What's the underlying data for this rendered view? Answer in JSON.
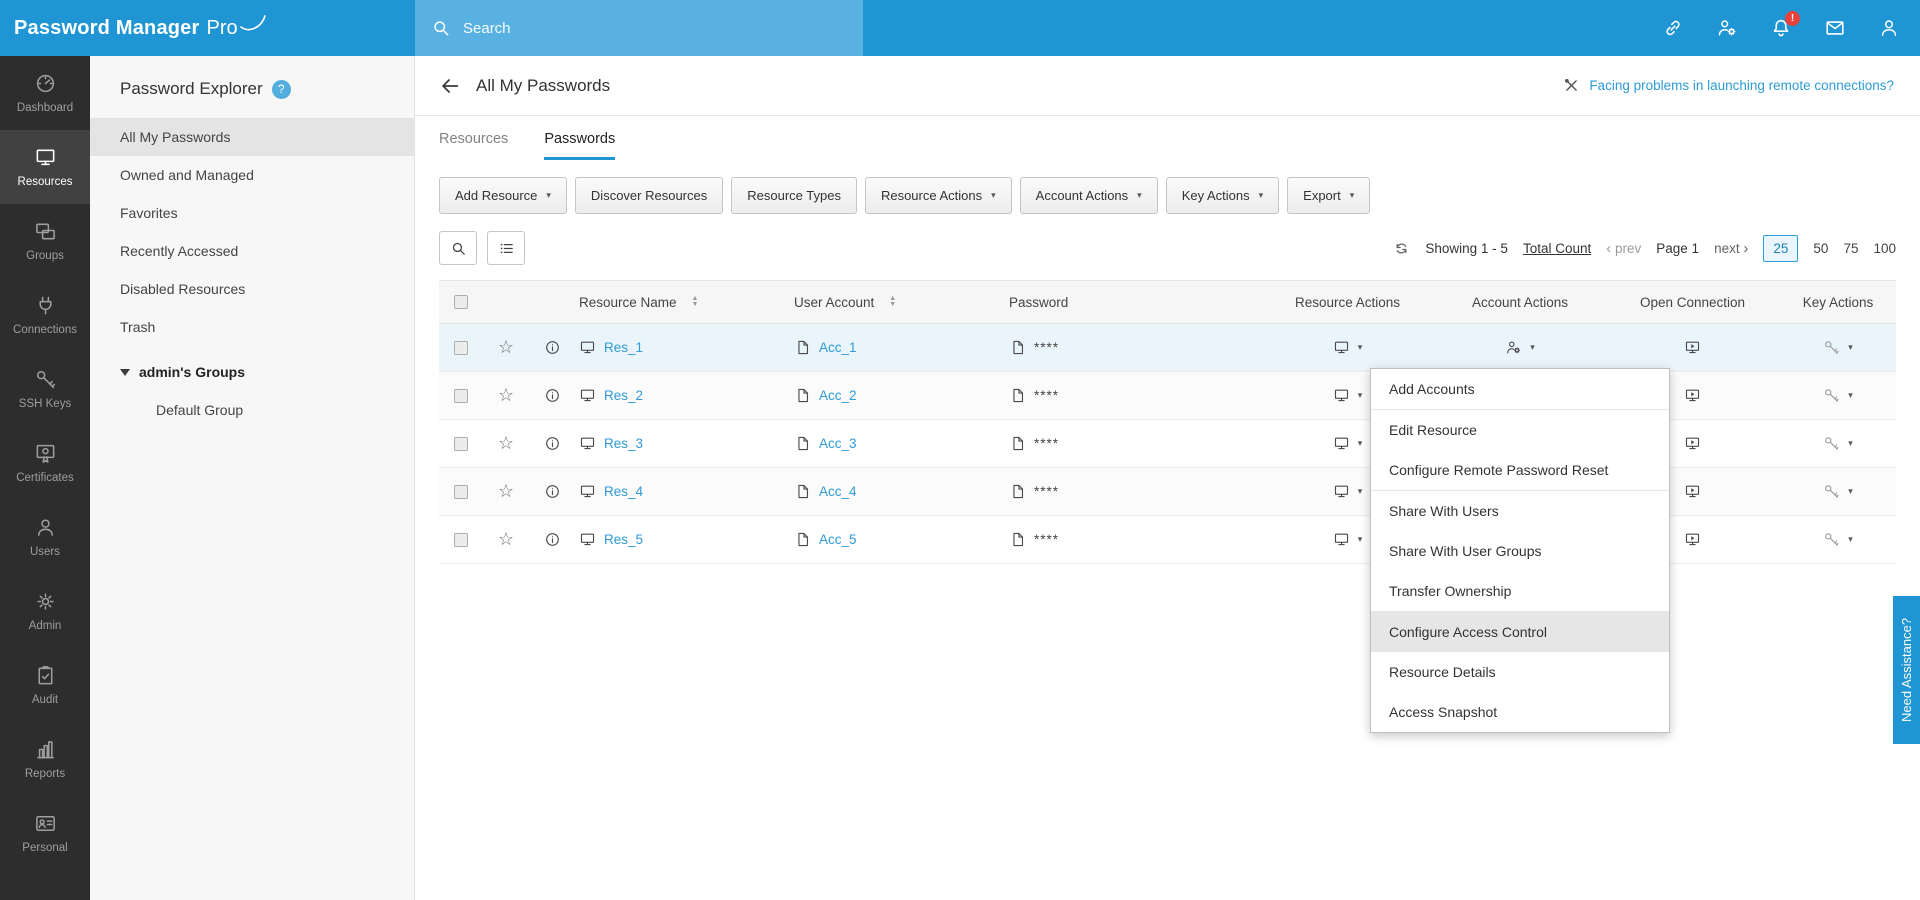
{
  "topbar": {
    "logo_primary": "Password Manager",
    "logo_suffix": "Pro",
    "search_placeholder": "Search",
    "notification_badge": "!"
  },
  "sidebar": {
    "items": [
      {
        "label": "Dashboard",
        "icon": "dashboard-icon",
        "active": false
      },
      {
        "label": "Resources",
        "icon": "resources-icon",
        "active": true
      },
      {
        "label": "Groups",
        "icon": "groups-icon",
        "active": false
      },
      {
        "label": "Connections",
        "icon": "connections-icon",
        "active": false
      },
      {
        "label": "SSH Keys",
        "icon": "ssh-keys-icon",
        "active": false
      },
      {
        "label": "Certificates",
        "icon": "certificates-icon",
        "active": false
      },
      {
        "label": "Users",
        "icon": "users-icon",
        "active": false
      },
      {
        "label": "Admin",
        "icon": "admin-gear-icon",
        "active": false
      },
      {
        "label": "Audit",
        "icon": "audit-icon",
        "active": false
      },
      {
        "label": "Reports",
        "icon": "reports-icon",
        "active": false
      },
      {
        "label": "Personal",
        "icon": "personal-icon",
        "active": false
      }
    ]
  },
  "explorer": {
    "title": "Password Explorer",
    "items": [
      {
        "label": "All My Passwords",
        "selected": true
      },
      {
        "label": "Owned and Managed",
        "selected": false
      },
      {
        "label": "Favorites",
        "selected": false
      },
      {
        "label": "Recently Accessed",
        "selected": false
      },
      {
        "label": "Disabled Resources",
        "selected": false
      },
      {
        "label": "Trash",
        "selected": false
      }
    ],
    "tree": {
      "group": "admin's Groups",
      "child": "Default Group"
    }
  },
  "header": {
    "title": "All My Passwords",
    "help_link": "Facing problems in launching remote connections?"
  },
  "tabs": [
    {
      "label": "Resources",
      "active": false
    },
    {
      "label": "Passwords",
      "active": true
    }
  ],
  "toolbar": [
    {
      "label": "Add Resource",
      "dropdown": true
    },
    {
      "label": "Discover Resources",
      "dropdown": false
    },
    {
      "label": "Resource Types",
      "dropdown": false
    },
    {
      "label": "Resource Actions",
      "dropdown": true
    },
    {
      "label": "Account Actions",
      "dropdown": true
    },
    {
      "label": "Key Actions",
      "dropdown": true
    },
    {
      "label": "Export",
      "dropdown": true
    }
  ],
  "pagination": {
    "showing": "Showing 1 - 5",
    "total_count": "Total Count",
    "prev": "prev",
    "page": "Page 1",
    "next": "next",
    "sizes": [
      "25",
      "50",
      "75",
      "100"
    ],
    "active_size": "25"
  },
  "table": {
    "columns": [
      "Resource Name",
      "User Account",
      "Password",
      "Resource Actions",
      "Account Actions",
      "Open Connection",
      "Key Actions"
    ],
    "rows": [
      {
        "resource": "Res_1",
        "account": "Acc_1",
        "password": "****"
      },
      {
        "resource": "Res_2",
        "account": "Acc_2",
        "password": "****"
      },
      {
        "resource": "Res_3",
        "account": "Acc_3",
        "password": "****"
      },
      {
        "resource": "Res_4",
        "account": "Acc_4",
        "password": "****"
      },
      {
        "resource": "Res_5",
        "account": "Acc_5",
        "password": "****"
      }
    ]
  },
  "context_menu": {
    "items": [
      "Add Accounts",
      "Edit Resource",
      "Configure Remote Password Reset",
      "Share With Users",
      "Share With User Groups",
      "Transfer Ownership",
      "Configure Access Control",
      "Resource Details",
      "Access Snapshot"
    ],
    "highlighted": "Configure Access Control"
  },
  "assistance_tab": "Need Assistance?",
  "icons": {
    "star": "☆",
    "caret_down": "▾",
    "sort_asc": "▲",
    "sort_desc": "▼",
    "chevron_left": "‹",
    "chevron_right": "›",
    "help": "?"
  },
  "colors": {
    "topbar": "#1f96d3",
    "accent": "#2196d3",
    "link": "#2e9bd6",
    "selected_row": "#e9f4fb",
    "badge": "#e8413c",
    "sidebar_bg": "#2d2d2d"
  }
}
